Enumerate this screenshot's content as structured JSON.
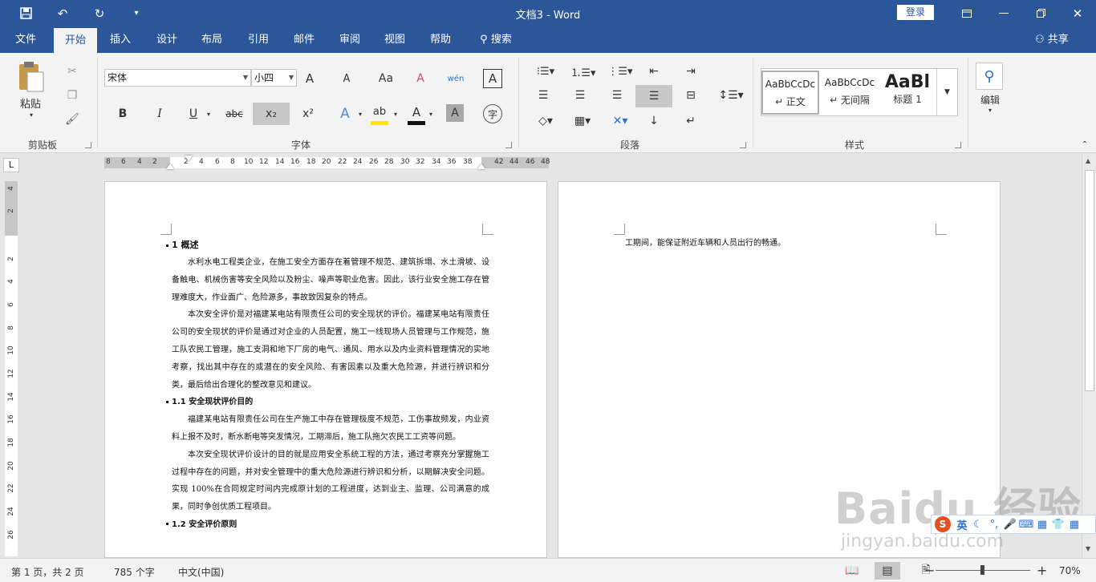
{
  "window": {
    "title": "文档3 - Word",
    "login": "登录",
    "share": "共享"
  },
  "tabs": [
    "文件",
    "开始",
    "插入",
    "设计",
    "布局",
    "引用",
    "邮件",
    "审阅",
    "视图",
    "帮助"
  ],
  "search": {
    "label": "搜索"
  },
  "ribbon": {
    "clipboard": {
      "paste": "粘贴",
      "label": "剪贴板"
    },
    "font": {
      "name": "宋体",
      "size": "小四",
      "label": "字体",
      "bold": "B",
      "italic": "I",
      "underline": "U",
      "strike": "abc",
      "subscript": "x₂",
      "superscript": "x²",
      "grow": "A",
      "shrink": "A",
      "case": "Aa",
      "clear": "A",
      "phonetic": "wén",
      "border": "A",
      "effects": "A",
      "color": "A",
      "shade": "A",
      "enclose": "字"
    },
    "paragraph": {
      "label": "段落"
    },
    "styles": {
      "label": "样式",
      "items": [
        {
          "preview": "AaBbCcDc",
          "name": "↵ 正文"
        },
        {
          "preview": "AaBbCcDc",
          "name": "↵ 无间隔"
        },
        {
          "preview": "AaBl",
          "name": "标题 1"
        }
      ]
    },
    "editing": {
      "label": "编辑"
    }
  },
  "ruler": {
    "corner": "L",
    "h_ticks": [
      "8",
      "6",
      "4",
      "2",
      "",
      "2",
      "4",
      "6",
      "8",
      "10",
      "12",
      "14",
      "16",
      "18",
      "20",
      "22",
      "24",
      "26",
      "28",
      "30",
      "32",
      "34",
      "36",
      "38",
      "",
      "42",
      "44",
      "46",
      "48"
    ],
    "v_ticks": [
      "4",
      "2",
      "",
      "2",
      "4",
      "6",
      "8",
      "10",
      "12",
      "14",
      "16",
      "18",
      "20",
      "22",
      "24",
      "26"
    ]
  },
  "document": {
    "page1": {
      "h1": "1  概述",
      "p1": "水利水电工程类企业，在施工安全方面存在着管理不规范、建筑拆塌、水土滑坡、设备触电、机械伤害等安全风险以及粉尘、噪声等职业危害。因此，该行业安全施工存在管理难度大，作业面广、危险源多，事故致因复杂的特点。",
      "p2": "本次安全评价是对福建某电站有限责任公司的安全现状的评价。福建某电站有限责任公司的安全现状的评价是通过对企业的人员配置，施工一线现场人员管理与工作规范，施工队农民工管理，施工支洞和地下厂房的电气、通风、用水以及内业资料管理情况的实地考察，找出其中存在的或潜在的安全风险、有害因素以及重大危险源，并进行辨识和分类，最后给出合理化的整改意见和建议。",
      "h2a": "1.1 安全现状评价目的",
      "p3": "福建某电站有限责任公司在生产施工中存在管理极度不规范，工伤事故频发，内业资料上报不及时，断水断电等突发情况，工期滞后，施工队拖欠农民工工资等问题。",
      "p4": "本次安全现状评价设计的目的就是应用安全系统工程的方法，通过考察充分掌握施工过程中存在的问题，并对安全管理中的重大危险源进行辨识和分析，以期解决安全问题。实现 100%在合同规定时间内完成原计划的工程进度，达到业主、监理、公司满意的成果，同时争创优质工程项目。",
      "h2b": "1.2 安全评价原则"
    },
    "page2": {
      "p1": "工期间，能保证附近车辆和人员出行的畅通。"
    }
  },
  "status": {
    "page": "第 1 页，共 2 页",
    "words": "785 个字",
    "lang": "中文(中国)",
    "zoom": "70%",
    "zoom_minus": "−",
    "zoom_plus": "+"
  },
  "ime": {
    "logo": "S",
    "lang": "英"
  },
  "watermark": {
    "main": "Baidu 经验",
    "sub": "jingyan.baidu.com"
  }
}
